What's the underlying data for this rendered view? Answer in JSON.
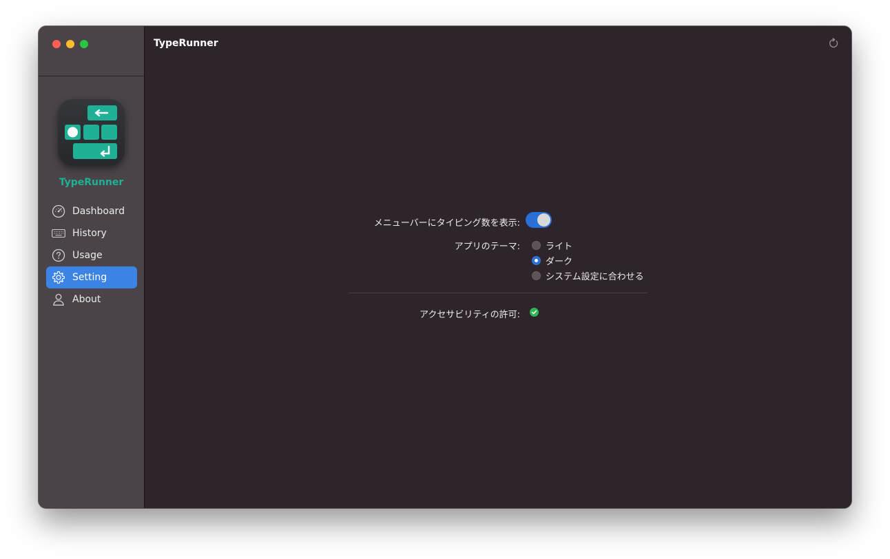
{
  "window": {
    "controls": [
      "close",
      "minimize",
      "zoom"
    ]
  },
  "sidebar": {
    "app_name": "TypeRunner",
    "items": [
      {
        "label": "Dashboard",
        "icon": "gauge-icon",
        "active": false
      },
      {
        "label": "History",
        "icon": "keyboard-icon",
        "active": false
      },
      {
        "label": "Usage",
        "icon": "question-circle-icon",
        "active": false
      },
      {
        "label": "Setting",
        "icon": "gear-icon",
        "active": true
      },
      {
        "label": "About",
        "icon": "person-icon",
        "active": false
      }
    ]
  },
  "header": {
    "title": "TypeRunner",
    "refresh_icon": "refresh-icon"
  },
  "settings": {
    "menubar_label": "メニューバーにタイピング数を表示:",
    "menubar_toggle": true,
    "theme_label": "アプリのテーマ:",
    "theme_options": [
      "ライト",
      "ダーク",
      "システム設定に合わせる"
    ],
    "theme_selected": "ダーク",
    "accessibility_label": "アクセサビリティの許可:",
    "accessibility_granted": true
  },
  "colors": {
    "accent": "#3b84e5",
    "brand": "#1fb095",
    "success": "#2fb653"
  }
}
